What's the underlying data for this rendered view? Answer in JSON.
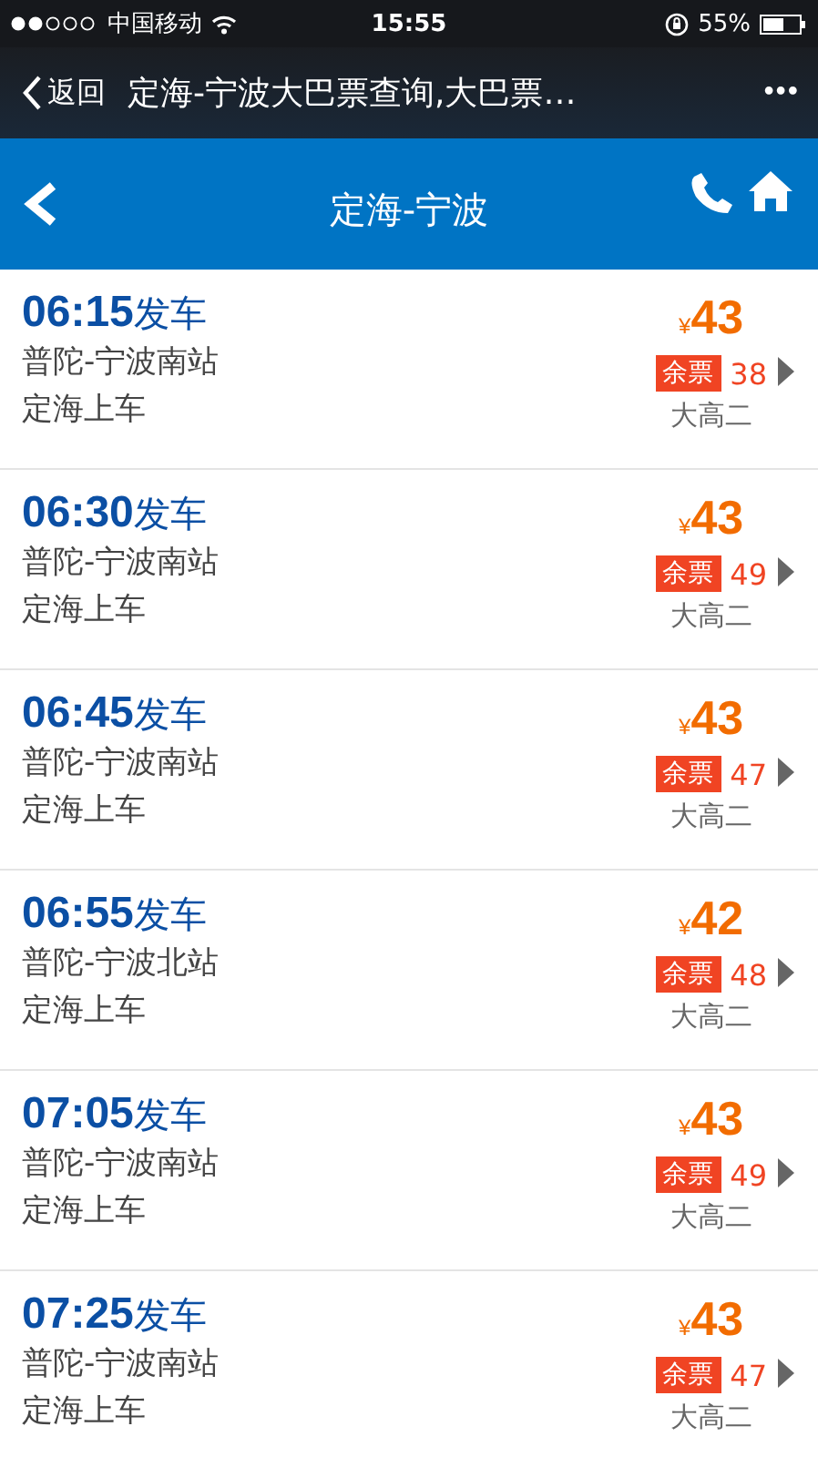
{
  "status_bar": {
    "carrier": "中国移动",
    "time": "15:55",
    "battery": "55%"
  },
  "nav_bar": {
    "back": "返回",
    "title": "定海-宁波大巴票查询,大巴票…",
    "more": "•••"
  },
  "header": {
    "title": "定海-宁波"
  },
  "trips": [
    {
      "time": "06:15",
      "suffix": "发车",
      "route": "普陀-宁波南站",
      "boarding": "定海上车",
      "currency": "¥",
      "price": "43",
      "badge": "余票",
      "remaining": "38",
      "bus_type": "大高二"
    },
    {
      "time": "06:30",
      "suffix": "发车",
      "route": "普陀-宁波南站",
      "boarding": "定海上车",
      "currency": "¥",
      "price": "43",
      "badge": "余票",
      "remaining": "49",
      "bus_type": "大高二"
    },
    {
      "time": "06:45",
      "suffix": "发车",
      "route": "普陀-宁波南站",
      "boarding": "定海上车",
      "currency": "¥",
      "price": "43",
      "badge": "余票",
      "remaining": "47",
      "bus_type": "大高二"
    },
    {
      "time": "06:55",
      "suffix": "发车",
      "route": "普陀-宁波北站",
      "boarding": "定海上车",
      "currency": "¥",
      "price": "42",
      "badge": "余票",
      "remaining": "48",
      "bus_type": "大高二"
    },
    {
      "time": "07:05",
      "suffix": "发车",
      "route": "普陀-宁波南站",
      "boarding": "定海上车",
      "currency": "¥",
      "price": "43",
      "badge": "余票",
      "remaining": "49",
      "bus_type": "大高二"
    },
    {
      "time": "07:25",
      "suffix": "发车",
      "route": "普陀-宁波南站",
      "boarding": "定海上车",
      "currency": "¥",
      "price": "43",
      "badge": "余票",
      "remaining": "47",
      "bus_type": "大高二"
    }
  ]
}
